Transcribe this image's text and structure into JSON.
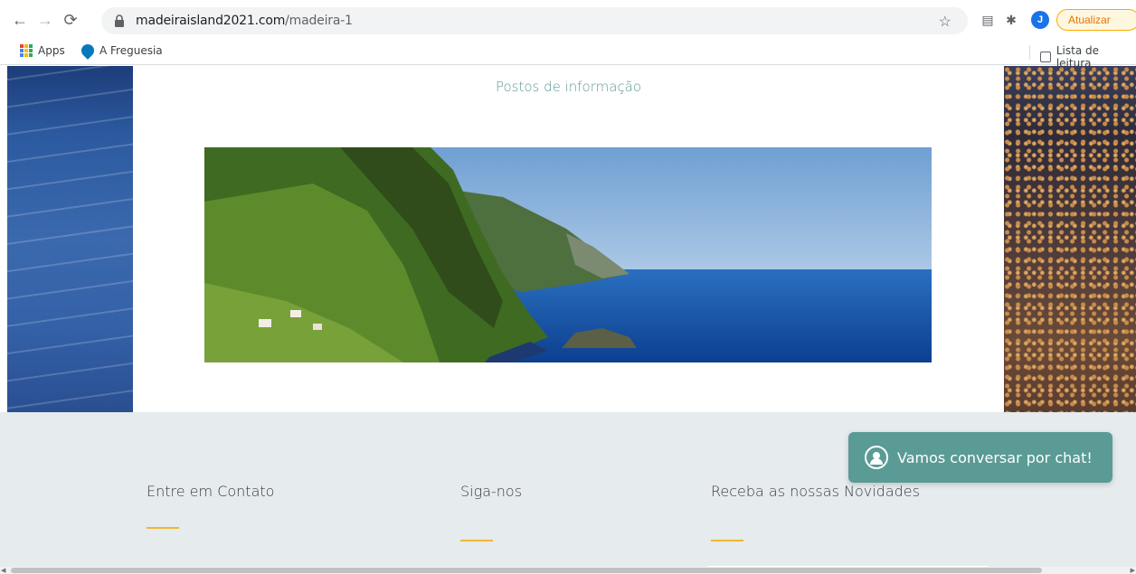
{
  "browser": {
    "url_domain": "madeiraisland2021.com",
    "url_path": "/madeira-1",
    "profile_initial": "J",
    "update_label": "Atualizar"
  },
  "bookmarks": {
    "items": [
      {
        "label": "Apps",
        "icon": "apps-grid-icon"
      },
      {
        "label": "A Freguesia",
        "icon": "drupal-icon"
      }
    ],
    "reading_list": "Lista de leitura"
  },
  "page": {
    "info_link": "Postos de informação",
    "banner_alt": "Madeira coastline"
  },
  "footer": {
    "contact_title": "Entre em Contato",
    "follow_title": "Siga-nos",
    "newsletter_title": "Receba as nossas Novidades"
  },
  "chat": {
    "label": "Vamos conversar por chat!"
  },
  "colors": {
    "accent": "#5a9b95",
    "footer_line": "#f2b630",
    "footer_bg": "#e6ebed"
  }
}
